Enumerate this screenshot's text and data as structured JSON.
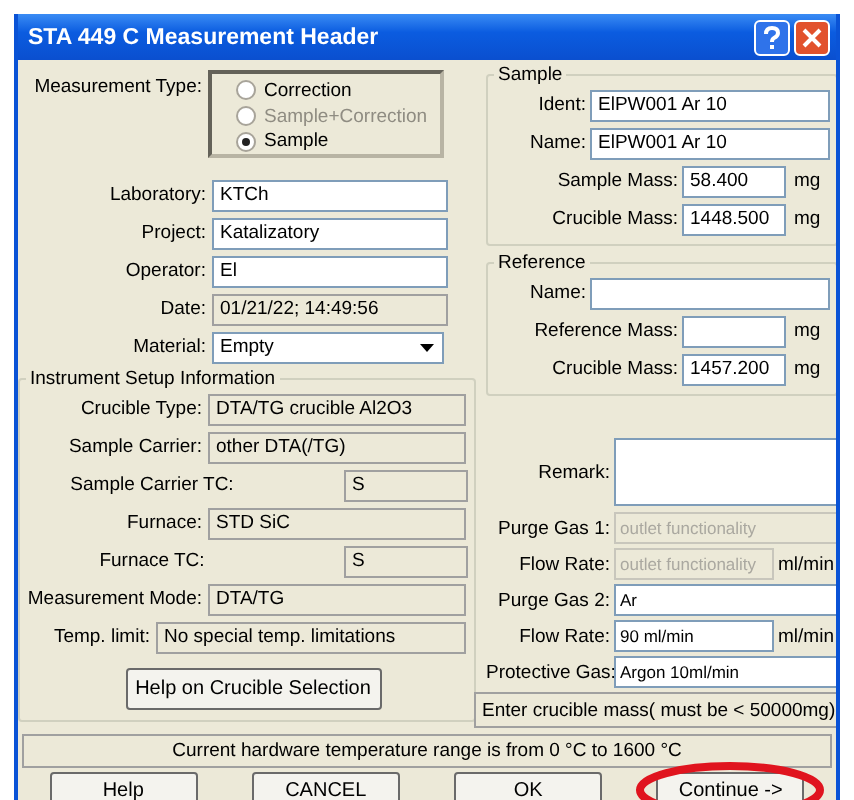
{
  "window": {
    "title": "STA 449 C  Measurement Header"
  },
  "measurement_type": {
    "label": "Measurement Type:",
    "options": [
      {
        "label": "Correction",
        "selected": false,
        "disabled": false
      },
      {
        "label": "Sample+Correction",
        "selected": false,
        "disabled": true
      },
      {
        "label": "Sample",
        "selected": true,
        "disabled": false
      }
    ]
  },
  "header_fields": [
    {
      "label": "Laboratory:",
      "value": "KTCh",
      "kind": "text"
    },
    {
      "label": "Project:",
      "value": "Katalizatory",
      "kind": "text"
    },
    {
      "label": "Operator:",
      "value": "El",
      "kind": "text"
    },
    {
      "label": "Date:",
      "value": "01/21/22; 14:49:56",
      "kind": "readonly"
    },
    {
      "label": "Material:",
      "value": "Empty",
      "kind": "dropdown"
    }
  ],
  "instrument_setup": {
    "title": "Instrument Setup Information",
    "fields": [
      {
        "label": "Crucible Type:",
        "value": "DTA/TG crucible Al2O3",
        "kind": "normal"
      },
      {
        "label": "Sample Carrier:",
        "value": "other DTA(/TG)",
        "kind": "normal"
      },
      {
        "label": "Sample Carrier TC:",
        "value": "S",
        "kind": "short"
      },
      {
        "label": "Furnace:",
        "value": "STD SiC",
        "kind": "normal"
      },
      {
        "label": "Furnace TC:",
        "value": "S",
        "kind": "short"
      },
      {
        "label": "Measurement Mode:",
        "value": "DTA/TG",
        "kind": "normal"
      },
      {
        "label": "Temp. limit:",
        "value": "No special temp. limitations",
        "kind": "wide"
      }
    ],
    "button": "Help on Crucible Selection"
  },
  "sample": {
    "title": "Sample",
    "fields": [
      {
        "label": "Ident:",
        "value": "ElPW001 Ar 10",
        "kind": "text"
      },
      {
        "label": "Name:",
        "value": "ElPW001 Ar 10",
        "kind": "text"
      },
      {
        "label": "Sample Mass:",
        "value": "58.400",
        "unit": "mg",
        "kind": "mass"
      },
      {
        "label": "Crucible Mass:",
        "value": "1448.500",
        "unit": "mg",
        "kind": "mass"
      }
    ]
  },
  "reference": {
    "title": "Reference",
    "fields": [
      {
        "label": "Name:",
        "kind": "text"
      },
      {
        "label": "Reference Mass:",
        "unit": "mg",
        "kind": "mass"
      },
      {
        "label": "Crucible Mass:",
        "value": "1457.200",
        "unit": "mg",
        "kind": "mass"
      }
    ]
  },
  "remark": {
    "label": "Remark:"
  },
  "gas_fields": [
    {
      "label": "Purge Gas 1:",
      "value": "outlet functionality",
      "disabled": true
    },
    {
      "label": "Flow Rate:",
      "value": "outlet functionality",
      "unit": "ml/min",
      "disabled": true
    },
    {
      "label": "Purge Gas 2:",
      "value": "Ar",
      "disabled": false
    },
    {
      "label": "Flow Rate:",
      "value": "90 ml/min",
      "unit": "ml/min",
      "disabled": false
    },
    {
      "label": "Protective Gas:",
      "value": "Argon 10ml/min",
      "disabled": false
    }
  ],
  "hint": "Enter crucible mass( must be <  50000mg)",
  "status": "Current hardware temperature range is from 0 °C to 1600 °C",
  "buttons": [
    {
      "label": "Help",
      "highlighted": false
    },
    {
      "label": "CANCEL",
      "highlighted": false
    },
    {
      "label": "OK",
      "highlighted": false
    },
    {
      "label": "Continue ->",
      "highlighted": true
    }
  ]
}
